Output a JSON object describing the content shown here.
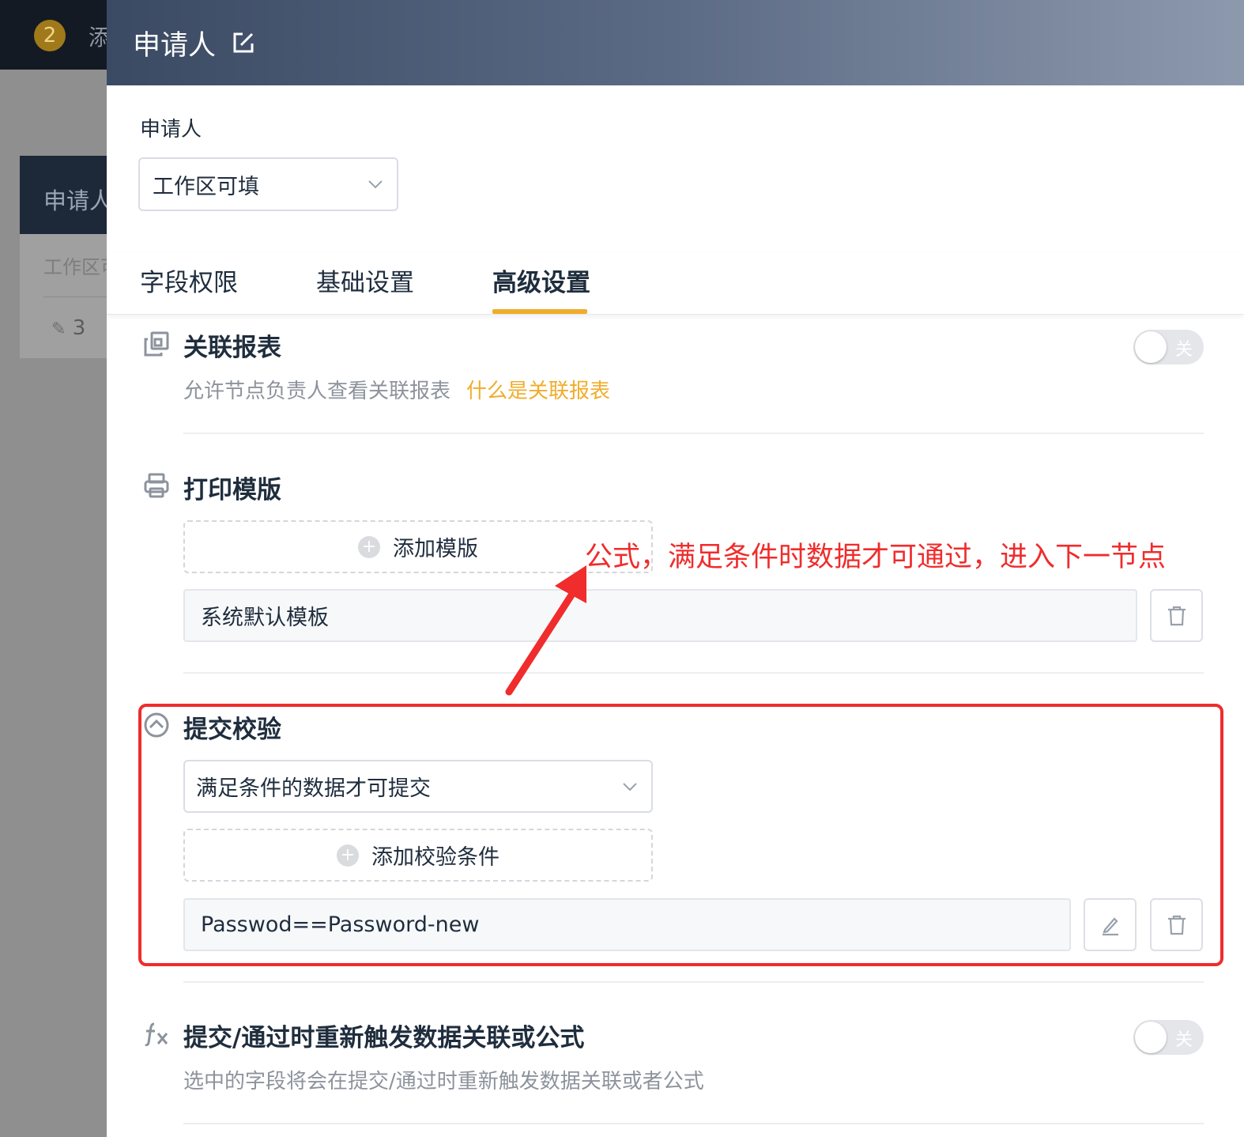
{
  "background": {
    "badge_count": "2",
    "top_text": "添",
    "card_title": "申请人",
    "card_sub": "工作区可",
    "card_count": "3"
  },
  "drawer": {
    "title": "申请人",
    "node_label": "申请人",
    "permission_select": "工作区可填",
    "tabs": [
      "字段权限",
      "基础设置",
      "高级设置"
    ],
    "active_tab": "高级设置"
  },
  "sections": {
    "linked_report": {
      "title": "关联报表",
      "desc": "允许节点负责人查看关联报表",
      "help_link": "什么是关联报表",
      "toggle_label": "关",
      "toggle_on": false
    },
    "print_template": {
      "title": "打印模版",
      "add_label": "添加模版",
      "items": [
        "系统默认模板"
      ]
    },
    "submit_validation": {
      "title": "提交校验",
      "mode_select": "满足条件的数据才可提交",
      "add_label": "添加校验条件",
      "conditions": [
        "Passwod==Password-new"
      ]
    },
    "retrigger": {
      "title": "提交/通过时重新触发数据关联或公式",
      "desc": "选中的字段将会在提交/通过时重新触发数据关联或者公式",
      "toggle_label": "关",
      "toggle_on": false
    }
  },
  "annotation": {
    "text": "公式，满足条件时数据才可通过，进入下一节点",
    "color": "#f02c2c"
  },
  "colors": {
    "accent": "#f0ad2b",
    "header_gradient_start": "#3b4a63",
    "header_gradient_end": "#8d99ad"
  }
}
